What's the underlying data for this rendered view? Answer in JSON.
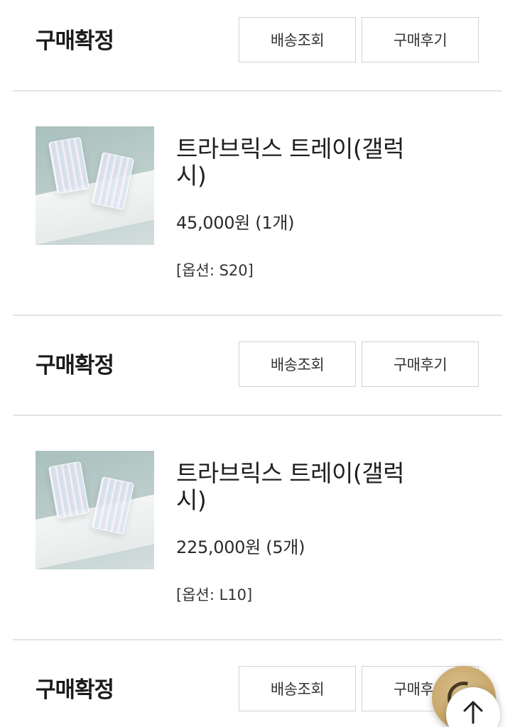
{
  "orders": [
    {
      "status": "구매확정",
      "track_label": "배송조회",
      "review_label": "구매후기",
      "product": {
        "name": "트라브릭스 트레이(갤럭시)",
        "price": "45,000원 (1개)",
        "option": "[옵션: S20]"
      }
    },
    {
      "status": "구매확정",
      "track_label": "배송조회",
      "review_label": "구매후기",
      "product": {
        "name": "트라브릭스 트레이(갤럭시)",
        "price": "225,000원 (5개)",
        "option": "[옵션: L10]"
      }
    },
    {
      "status": "구매확정",
      "track_label": "배송조회",
      "review_label": "구매후기"
    }
  ],
  "icons": {
    "chat": "chat-icon",
    "scroll_top": "arrow-up-icon"
  },
  "colors": {
    "chat_button": "#c9a86a",
    "divider": "#e3e3e3",
    "button_border": "#d2d2d2"
  }
}
